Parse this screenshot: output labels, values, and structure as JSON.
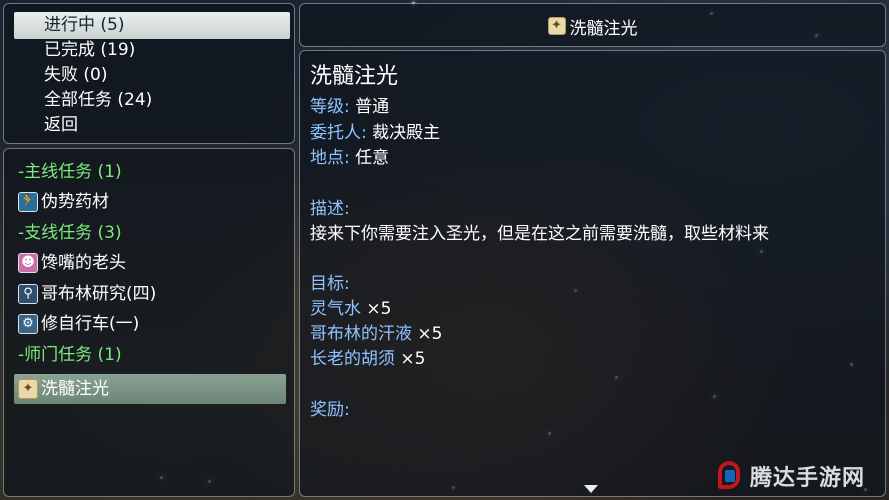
{
  "status_menu": {
    "items": [
      {
        "label": "进行中 (5)"
      },
      {
        "label": "已完成 (19)"
      },
      {
        "label": "失败 (0)"
      },
      {
        "label": "全部任务 (24)"
      },
      {
        "label": "返回"
      }
    ],
    "selected_index": 0
  },
  "quest_list": {
    "rows": [
      {
        "type": "group",
        "label": "-主线任务 (1)"
      },
      {
        "type": "quest",
        "icon": "running-figure-icon",
        "label": "伪势药材"
      },
      {
        "type": "group",
        "label": "-支线任务 (3)"
      },
      {
        "type": "quest",
        "icon": "ghost-face-icon",
        "label": "馋嘴的老头"
      },
      {
        "type": "quest",
        "icon": "magnifier-icon",
        "label": "哥布林研究(四)"
      },
      {
        "type": "quest",
        "icon": "bicycle-icon",
        "label": "修自行车(一)"
      },
      {
        "type": "group",
        "label": "-师门任务 (1)"
      },
      {
        "type": "quest",
        "icon": "scroll-icon",
        "label": "洗髓注光"
      }
    ],
    "selected_label": "洗髓注光"
  },
  "title_bar": {
    "icon": "scroll-icon",
    "label": "洗髓注光"
  },
  "detail": {
    "name": "洗髓注光",
    "level_label": "等级:",
    "level_value": "普通",
    "client_label": "委托人:",
    "client_value": "裁决殿主",
    "location_label": "地点:",
    "location_value": "任意",
    "description_label": "描述:",
    "description": "接来下你需要注入圣光，但是在这之前需要洗髓，取些材料来",
    "targets_label": "目标:",
    "targets": [
      {
        "name": "灵气水",
        "qty": "×5"
      },
      {
        "name": "哥布林的汗液",
        "qty": "×5"
      },
      {
        "name": "长老的胡须",
        "qty": "×5"
      }
    ],
    "reward_label": "奖励:"
  },
  "watermark": {
    "text": "腾达手游网"
  },
  "colors": {
    "group_green": "#7dea7d",
    "label_blue": "#8fc3ff",
    "selection": "#7b9386"
  }
}
